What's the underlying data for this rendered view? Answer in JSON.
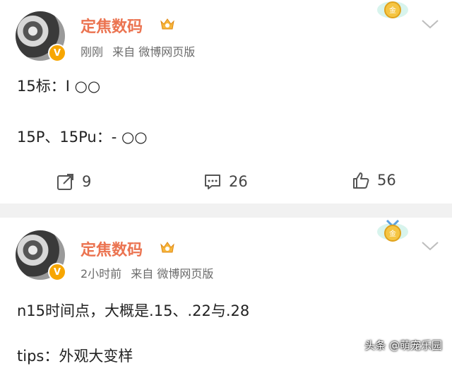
{
  "posts": [
    {
      "username": "定焦数码",
      "time": "刚刚",
      "source": "来自 微博网页版",
      "lines": [
        "15标：I ○○",
        "15P、15Pu：- ○○"
      ],
      "actions": {
        "repost": "9",
        "comment": "26",
        "like": "56"
      }
    },
    {
      "username": "定焦数码",
      "time": "2小时前",
      "source": "来自 微博网页版",
      "lines": [
        "n15时间点，大概是.15、.22与.28",
        "tips：外观大变样"
      ]
    }
  ],
  "watermark": "头条 @萌宠乐园",
  "icons": {
    "avatar_badge": "v-badge-icon",
    "vip": "vip-crown-icon",
    "medal": "gold-medal-icon",
    "expand": "chevron-down-icon",
    "repost": "repost-icon",
    "comment": "comment-icon",
    "like": "thumbs-up-icon"
  },
  "colors": {
    "username": "#eb7350",
    "badge": "#f7a600",
    "divider": "#f1f1f1"
  }
}
